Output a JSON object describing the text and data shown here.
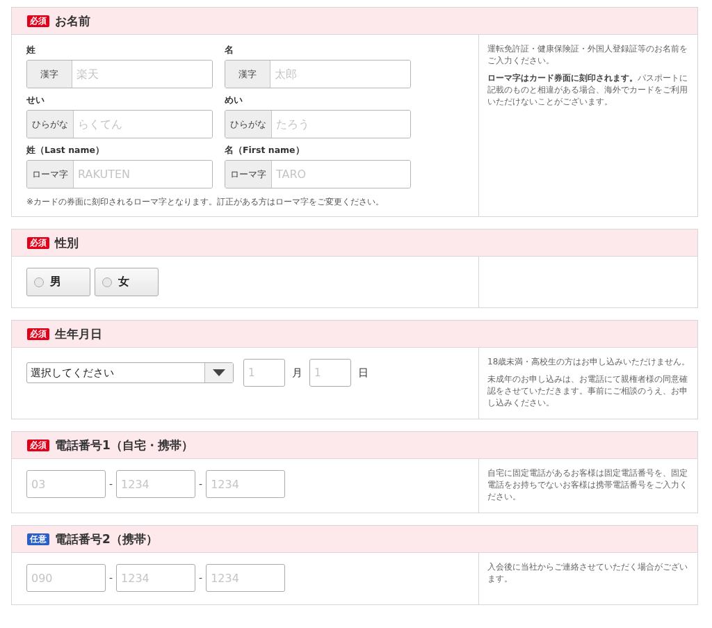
{
  "sections": [
    {
      "badge": {
        "text": "必須",
        "kind": "required"
      },
      "title": "お名前",
      "kind": "name",
      "groups": [
        {
          "label": "姓",
          "addon": "漢字",
          "placeholder": "楽天"
        },
        {
          "label": "名",
          "addon": "漢字",
          "placeholder": "太郎"
        },
        {
          "label": "せい",
          "addon": "ひらがな",
          "placeholder": "らくてん"
        },
        {
          "label": "めい",
          "addon": "ひらがな",
          "placeholder": "たろう"
        },
        {
          "label": "姓（Last name）",
          "addon": "ローマ字",
          "placeholder": "RAKUTEN"
        },
        {
          "label": "名（First name）",
          "addon": "ローマ字",
          "placeholder": "TARO"
        }
      ],
      "footnote": "※カードの券面に刻印されるローマ字となります。訂正がある方はローマ字をご変更ください。",
      "notes": [
        "運転免許証・健康保険証・外国人登録証等のお名前をご入力ください。",
        "**ローマ字はカード券面に刻印されます。**パスポートに記載のものと相違がある場合、海外でカードをご利用いただけないことがございます。"
      ]
    },
    {
      "badge": {
        "text": "必須",
        "kind": "required"
      },
      "title": "性別",
      "kind": "radio",
      "options": [
        {
          "label": "男",
          "selected": false
        },
        {
          "label": "女",
          "selected": false
        }
      ]
    },
    {
      "badge": {
        "text": "必須",
        "kind": "required"
      },
      "title": "生年月日",
      "kind": "date",
      "select": {
        "value": "選択してください"
      },
      "parts": [
        {
          "placeholder": "1",
          "unit": "月"
        },
        {
          "placeholder": "1",
          "unit": "日"
        }
      ],
      "notes": [
        "18歳未満・高校生の方はお申し込みいただけません。",
        "未成年のお申し込みは、お電話にて親権者様の同意確認をさせていただきます。事前にご相談のうえ、お申し込みください。"
      ]
    },
    {
      "badge": {
        "text": "必須",
        "kind": "required"
      },
      "title": "電話番号1（自宅・携帯）",
      "kind": "phone",
      "parts": [
        {
          "placeholder": "03"
        },
        {
          "separator": "-",
          "placeholder": "1234"
        },
        {
          "separator": "-",
          "placeholder": "1234"
        }
      ],
      "notes": [
        "自宅に固定電話があるお客様は固定電話番号を、固定電話をお持ちでないお客様は携帯電話番号をご入力ください。"
      ]
    },
    {
      "badge": {
        "text": "任意",
        "kind": "optional"
      },
      "title": "電話番号2（携帯）",
      "kind": "phone",
      "parts": [
        {
          "placeholder": "090"
        },
        {
          "separator": "-",
          "placeholder": "1234"
        },
        {
          "separator": "-",
          "placeholder": "1234"
        }
      ],
      "notes": [
        "入会後に当社からご連絡させていただく場合がございます。"
      ]
    }
  ]
}
